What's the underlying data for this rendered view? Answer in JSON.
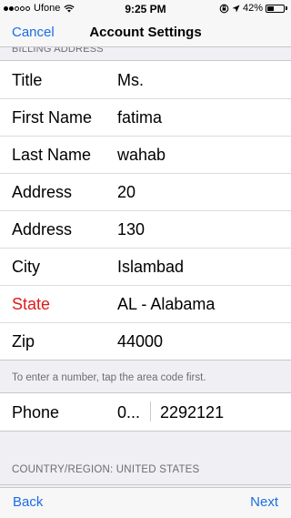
{
  "status_bar": {
    "carrier": "Ufone",
    "time": "9:25 PM",
    "battery": "42%",
    "battery_level": 0.42,
    "signal_bars_filled": 2,
    "signal_bars_total": 5
  },
  "nav": {
    "cancel": "Cancel",
    "title": "Account Settings"
  },
  "billing": {
    "section_header": "BILLING ADDRESS",
    "rows": [
      {
        "label": "Title",
        "value": "Ms."
      },
      {
        "label": "First Name",
        "value": "fatima"
      },
      {
        "label": "Last Name",
        "value": "wahab"
      },
      {
        "label": "Address",
        "value": "20"
      },
      {
        "label": "Address",
        "value": "130"
      },
      {
        "label": "City",
        "value": "Islambad"
      },
      {
        "label": "State",
        "value": "AL - Alabama",
        "required": true
      },
      {
        "label": "Zip",
        "value": "44000"
      }
    ],
    "footer_note": "To enter a number, tap the area code first."
  },
  "phone": {
    "label": "Phone",
    "area_code": "0...",
    "number": "2292121"
  },
  "country": {
    "header": "COUNTRY/REGION: UNITED STATES"
  },
  "toolbar": {
    "back": "Back",
    "next": "Next"
  },
  "colors": {
    "accent": "#1a6ee6",
    "required": "#e01b1b",
    "background": "#efeff4"
  }
}
